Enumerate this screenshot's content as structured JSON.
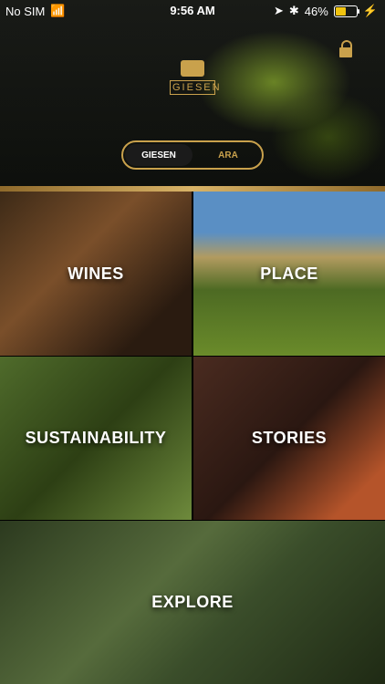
{
  "status_bar": {
    "carrier": "No SIM",
    "time": "9:56 AM",
    "battery_percent": "46%",
    "battery_level": 0.46
  },
  "brand": {
    "name": "GIESEN"
  },
  "toggle": {
    "options": [
      "GIESEN",
      "ARA"
    ],
    "selected": "GIESEN"
  },
  "tiles": {
    "wines": "WINES",
    "place": "PLACE",
    "sustainability": "SUSTAINABILITY",
    "stories": "STORIES",
    "explore": "EXPLORE"
  },
  "colors": {
    "gold": "#c9a14c"
  },
  "icons": {
    "wifi": "wifi-icon",
    "location": "location-arrow-icon",
    "bluetooth": "bluetooth-icon",
    "battery": "battery-icon",
    "charging": "charging-bolt-icon",
    "lock": "lock-icon"
  }
}
